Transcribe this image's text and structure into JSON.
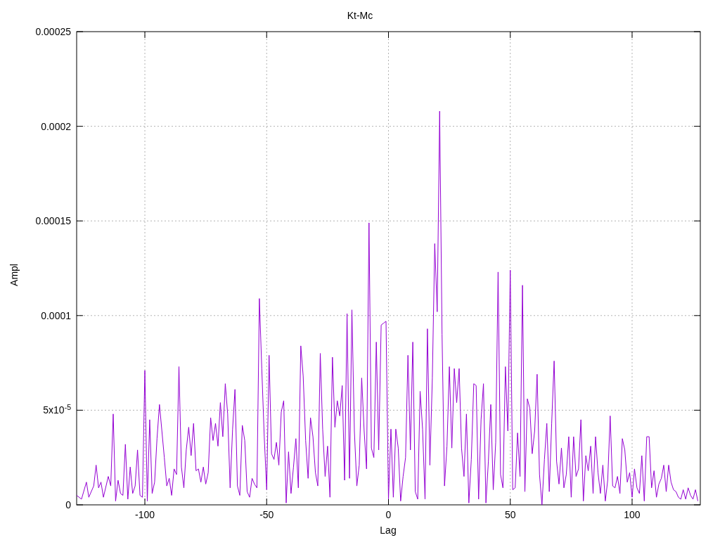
{
  "chart_data": {
    "type": "line",
    "grid": true,
    "title": "Kt-Mc",
    "xlabel": "Lag",
    "ylabel": "Ampl",
    "xlim": [
      -128,
      128
    ],
    "ylim": [
      0,
      0.00025
    ],
    "xticks": [
      -100,
      -50,
      0,
      50,
      100
    ],
    "yticks": [
      {
        "value": 0,
        "label": "0"
      },
      {
        "value": 5e-05,
        "label": "5x10$^{-5}$"
      },
      {
        "value": 0.0001,
        "label": "0.0001"
      },
      {
        "value": 0.00015,
        "label": "0.00015"
      },
      {
        "value": 0.0002,
        "label": "0.0002"
      },
      {
        "value": 0.00025,
        "label": "0.00025"
      }
    ],
    "x": [
      -128,
      -126,
      -124,
      -123,
      -121,
      -120,
      -119,
      -118,
      -117,
      -115,
      -114,
      -113,
      -112,
      -111,
      -110,
      -109,
      -108,
      -107,
      -106,
      -105,
      -104,
      -103,
      -102,
      -101,
      -100,
      -99,
      -98,
      -97,
      -96,
      -95,
      -94,
      -92,
      -91,
      -90,
      -89,
      -88,
      -87,
      -86,
      -85,
      -84,
      -83,
      -82,
      -81,
      -80,
      -79,
      -78,
      -77,
      -76,
      -75,
      -74,
      -73,
      -72,
      -71,
      -70,
      -69,
      -68,
      -67,
      -66,
      -65,
      -64,
      -63,
      -62,
      -61,
      -60,
      -59,
      -58,
      -57,
      -56,
      -55,
      -54,
      -53,
      -52,
      -51,
      -50,
      -49,
      -48,
      -47,
      -46,
      -45,
      -44,
      -43,
      -42,
      -41,
      -40,
      -39,
      -38,
      -37,
      -36,
      -35,
      -34,
      -33,
      -32,
      -31,
      -30,
      -29,
      -28,
      -27,
      -26,
      -25,
      -24,
      -23,
      -22,
      -21,
      -20,
      -19,
      -18,
      -17,
      -16,
      -15,
      -14,
      -13,
      -12,
      -11,
      -10,
      -9,
      -8,
      -7,
      -6,
      -5,
      -4,
      -3,
      -2,
      -1,
      0,
      1,
      2,
      3,
      4,
      5,
      6,
      7,
      8,
      9,
      10,
      11,
      12,
      13,
      14,
      15,
      16,
      17,
      18,
      19,
      20,
      21,
      22,
      23,
      24,
      25,
      26,
      27,
      28,
      29,
      30,
      31,
      32,
      33,
      34,
      35,
      36,
      37,
      38,
      39,
      40,
      41,
      42,
      43,
      44,
      45,
      46,
      47,
      48,
      49,
      50,
      51,
      52,
      53,
      54,
      55,
      56,
      57,
      58,
      59,
      60,
      61,
      62,
      63,
      64,
      65,
      66,
      67,
      68,
      69,
      70,
      71,
      72,
      73,
      74,
      75,
      76,
      77,
      78,
      79,
      80,
      81,
      82,
      83,
      84,
      85,
      86,
      87,
      88,
      89,
      90,
      91,
      92,
      93,
      94,
      95,
      96,
      97,
      98,
      99,
      100,
      101,
      102,
      103,
      104,
      105,
      106,
      107,
      108,
      109,
      110,
      111,
      112,
      113,
      114,
      115,
      116,
      117,
      118,
      119,
      120,
      121,
      122,
      123,
      124,
      125,
      126,
      127
    ],
    "series": [
      {
        "color": "#9400d3",
        "values": [
          5e-06,
          3e-06,
          1.2e-05,
          4e-06,
          1e-05,
          2.1e-05,
          9e-06,
          1.2e-05,
          4e-06,
          1.5e-05,
          1e-05,
          4.8e-05,
          2e-06,
          1.3e-05,
          6e-06,
          5e-06,
          3.2e-05,
          3e-06,
          2e-05,
          6e-06,
          1e-05,
          2.9e-05,
          5e-06,
          4e-06,
          7.1e-05,
          2e-06,
          4.5e-05,
          6e-06,
          1.2e-05,
          3.5e-05,
          5.3e-05,
          2.5e-05,
          1e-05,
          1.4e-05,
          5e-06,
          1.9e-05,
          1.6e-05,
          7.3e-05,
          2e-05,
          9e-06,
          2.9e-05,
          4.1e-05,
          2.6e-05,
          4.3e-05,
          1.8e-05,
          1.9e-05,
          1.2e-05,
          2e-05,
          1.1e-05,
          1.7e-05,
          4.6e-05,
          3.4e-05,
          4.3e-05,
          3.1e-05,
          5.4e-05,
          3.6e-05,
          6.4e-05,
          4.8e-05,
          9e-06,
          4e-05,
          6.1e-05,
          1e-05,
          5e-06,
          4.2e-05,
          3.4e-05,
          7e-06,
          4e-06,
          1.4e-05,
          1.1e-05,
          9e-06,
          0.000109,
          7.2e-05,
          3.6e-05,
          8e-06,
          7.9e-05,
          2.7e-05,
          2.4e-05,
          3.3e-05,
          2.1e-05,
          4.9e-05,
          5.5e-05,
          1e-06,
          2.8e-05,
          6e-06,
          2e-05,
          3.5e-05,
          9e-06,
          8.4e-05,
          6.8e-05,
          3.4e-05,
          1.4e-05,
          4.6e-05,
          3.6e-05,
          1.7e-05,
          1e-05,
          8e-05,
          4e-05,
          1.5e-05,
          3.1e-05,
          4e-06,
          7.8e-05,
          4.1e-05,
          5.5e-05,
          4.7e-05,
          6.3e-05,
          1.3e-05,
          0.000101,
          1.4e-05,
          0.000103,
          3.9e-05,
          1e-05,
          2.1e-05,
          6.7e-05,
          3.9e-05,
          1.9e-05,
          0.000149,
          3e-05,
          2.5e-05,
          8.6e-05,
          2.9e-05,
          9.5e-05,
          9.6e-05,
          9.7e-05,
          3e-06,
          4e-05,
          4e-06,
          4e-05,
          3e-05,
          2e-06,
          1.5e-05,
          2.5e-05,
          7.9e-05,
          2.9e-05,
          8.6e-05,
          7e-06,
          3e-06,
          6e-05,
          4e-05,
          3e-06,
          9.3e-05,
          2.1e-05,
          6.7e-05,
          0.000138,
          0.000102,
          0.000208,
          9e-05,
          1e-05,
          3.1e-05,
          7.3e-05,
          3e-05,
          7.2e-05,
          5.4e-05,
          7.2e-05,
          3e-05,
          1.5e-05,
          4.8e-05,
          1e-06,
          2.4e-05,
          6.4e-05,
          6.3e-05,
          3e-06,
          4.5e-05,
          6.4e-05,
          1e-06,
          2.3e-05,
          5.3e-05,
          8e-06,
          3.3e-05,
          0.000123,
          1.6e-05,
          9e-06,
          7.3e-05,
          3.9e-05,
          0.000124,
          8e-06,
          9e-06,
          3.8e-05,
          1.5e-05,
          0.000116,
          7e-06,
          5.6e-05,
          5.1e-05,
          2.7e-05,
          3.9e-05,
          6.9e-05,
          1.6e-05,
          0.0,
          2.4e-05,
          4.3e-05,
          7e-06,
          4.3e-05,
          7.6e-05,
          2.3e-05,
          1.1e-05,
          3e-05,
          9e-06,
          1.6e-05,
          3.6e-05,
          4e-06,
          3.6e-05,
          1.5e-05,
          1.9e-05,
          4.5e-05,
          2e-06,
          2.6e-05,
          1.8e-05,
          3.1e-05,
          6e-06,
          3.6e-05,
          1.7e-05,
          6e-06,
          2.1e-05,
          2e-06,
          1.3e-05,
          4.7e-05,
          1e-05,
          9e-06,
          1.5e-05,
          6e-06,
          3.5e-05,
          2.9e-05,
          1.2e-05,
          1.7e-05,
          4e-06,
          1.9e-05,
          9e-06,
          6e-06,
          2.6e-05,
          2e-06,
          3.6e-05,
          3.6e-05,
          9e-06,
          1.8e-05,
          4e-06,
          1.1e-05,
          1.4e-05,
          2.1e-05,
          7e-06,
          2.1e-05,
          1.2e-05,
          8e-06,
          7e-06,
          4e-06,
          3e-06,
          8e-06,
          3e-06,
          9e-06,
          5e-06,
          3e-06,
          8e-06,
          2e-06
        ]
      }
    ]
  }
}
